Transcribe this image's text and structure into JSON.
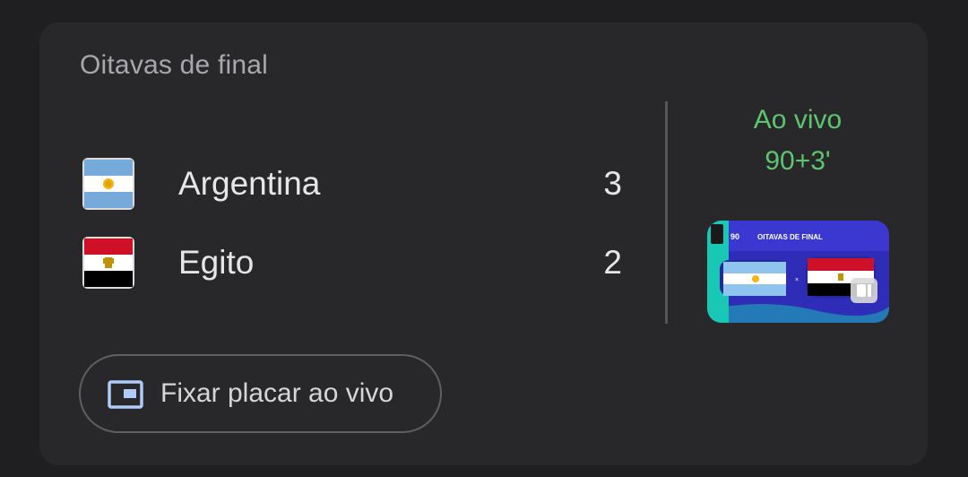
{
  "match": {
    "stage": "Oitavas de final",
    "status": "Ao vivo",
    "minute": "90+3'",
    "home": {
      "name": "Argentina",
      "score": "3",
      "flag_icon": "argentina-flag-icon"
    },
    "away": {
      "name": "Egito",
      "score": "2",
      "flag_icon": "egypt-flag-icon"
    }
  },
  "thumbnail": {
    "caption": "OITAVAS DE FINAL",
    "badge": "90"
  },
  "pin_button": {
    "label": "Fixar placar ao vivo",
    "icon": "picture-in-picture-icon"
  },
  "colors": {
    "background": "#1f1f21",
    "card": "#28282b",
    "live_green": "#5bc66e",
    "text_primary": "#e6e6e8",
    "text_secondary": "#a8a8ac",
    "icon_blue": "#aecbfa"
  }
}
